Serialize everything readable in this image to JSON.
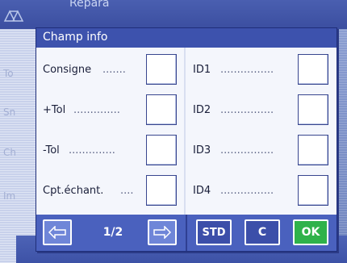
{
  "background": {
    "title_fragment": "Répara",
    "left_labels": [
      "To",
      "Sn",
      "Ch",
      "Im"
    ]
  },
  "dialog": {
    "title": "Champ info",
    "left_rows": [
      {
        "label": "Consigne",
        "dots": "......."
      },
      {
        "label": "+Tol",
        "dots": ".............."
      },
      {
        "label": "-Tol",
        "dots": ".............."
      },
      {
        "label": "Cpt.échant.",
        "dots": "...."
      }
    ],
    "right_rows": [
      {
        "label": "ID1",
        "dots": "................"
      },
      {
        "label": "ID2",
        "dots": "................"
      },
      {
        "label": "ID3",
        "dots": "................"
      },
      {
        "label": "ID4",
        "dots": "................"
      }
    ]
  },
  "footer": {
    "page_indicator": "1/2",
    "std_label": "STD",
    "c_label": "C",
    "ok_label": "OK",
    "prev_icon": "arrow-left-icon",
    "next_icon": "arrow-right-icon"
  },
  "colors": {
    "dialog_bg": "#4a61be",
    "body_bg": "#f4f6fc",
    "ok_green": "#2fb24a"
  }
}
